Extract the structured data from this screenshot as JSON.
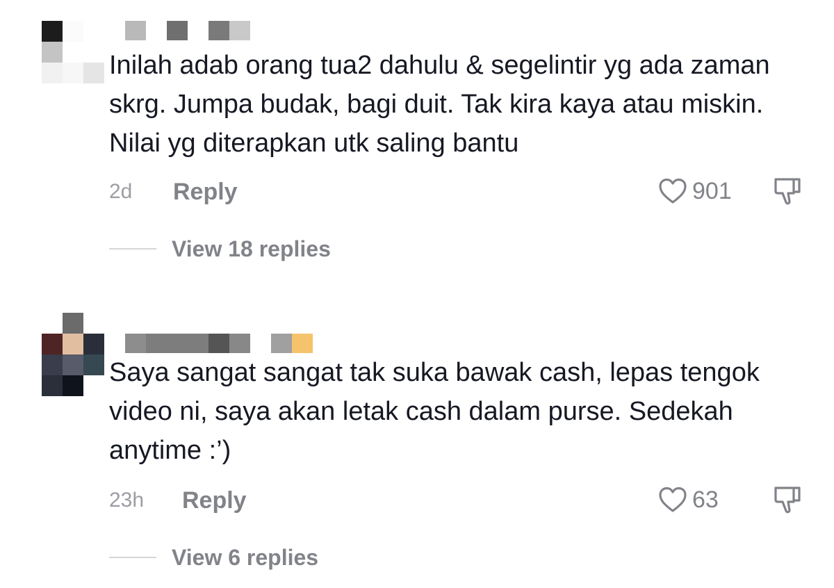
{
  "comments": [
    {
      "text": "Inilah adab orang tua2 dahulu & segelintir yg ada zaman skrg. Jumpa budak, bagi duit. Tak kira kaya atau miskin. Nilai yg diterapkan utk saling bantu",
      "time": "2d",
      "reply_label": "Reply",
      "likes": "901",
      "view_replies_label": "View 18 replies"
    },
    {
      "text": "Saya sangat sangat tak suka bawak cash, lepas tengok video ni, saya akan letak cash dalam purse. Sedekah anytime :’)",
      "time": "23h",
      "reply_label": "Reply",
      "likes": "63",
      "view_replies_label": "View 6 replies"
    }
  ],
  "icons": {
    "like": "heart-outline-icon",
    "dislike": "thumbs-down-outline-icon"
  },
  "colors": {
    "text_primary": "#161823",
    "text_secondary": "#818389",
    "text_time": "#9c9ca3"
  }
}
